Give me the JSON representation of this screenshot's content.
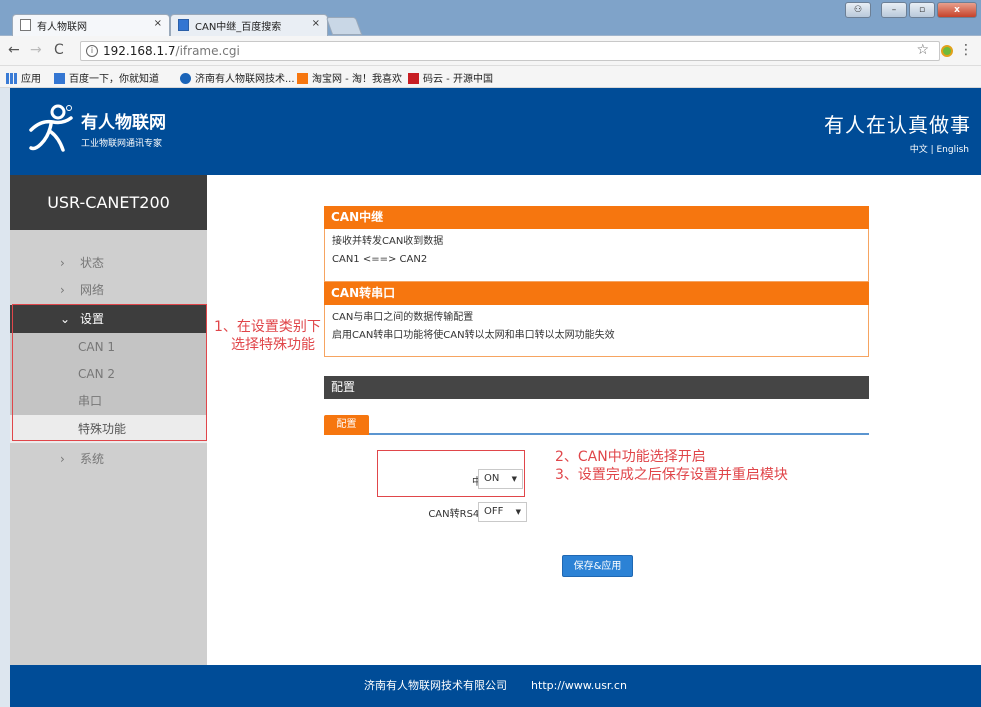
{
  "browser": {
    "tabs": [
      {
        "title": "有人物联网",
        "close": "×"
      },
      {
        "title": "CAN中继_百度搜索",
        "close": "×"
      }
    ],
    "url_host": "192.168.1.7",
    "url_path": "/iframe.cgi",
    "bookmarks": [
      "应用",
      "百度一下，你就知道",
      "济南有人物联网技术...",
      "淘宝网 - 淘！我喜欢",
      "码云 - 开源中国"
    ]
  },
  "header": {
    "brand_name": "有人物联网",
    "brand_sub": "工业物联网通讯专家",
    "slogan": "有人在认真做事",
    "lang_zh": "中文",
    "lang_sep": " | ",
    "lang_en": "English"
  },
  "sidebar": {
    "model": "USR-CANET200",
    "items": [
      {
        "chev": "›",
        "label": "状态"
      },
      {
        "chev": "›",
        "label": "网络"
      },
      {
        "chev": "⌄",
        "label": "设置"
      },
      {
        "label": "CAN 1"
      },
      {
        "label": "CAN 2"
      },
      {
        "label": "串口"
      },
      {
        "label": "特殊功能"
      },
      {
        "chev": "›",
        "label": "系统"
      }
    ]
  },
  "main": {
    "relay_title": "CAN中继",
    "relay_lines": [
      "接收并转发CAN收到数据",
      "CAN1 <==> CAN2"
    ],
    "serial_title": "CAN转串口",
    "serial_lines": [
      "CAN与串口之间的数据传输配置",
      "启用CAN转串口功能将使CAN转以太网和串口转以太网功能失效"
    ],
    "config_title": "配置",
    "config_tab": "配置",
    "fields": [
      {
        "label": "中继",
        "value": "ON"
      },
      {
        "label": "CAN转RS485",
        "value": "OFF"
      }
    ],
    "save_label": "保存&应用"
  },
  "annotations": {
    "note1_line1": "1、在设置类别下",
    "note1_line2": "选择特殊功能",
    "note2": "2、CAN中功能选择开启",
    "note3": "3、设置完成之后保存设置并重启模块"
  },
  "footer": {
    "company": "济南有人物联网技术有限公司",
    "url": "http://www.usr.cn"
  },
  "colors": {
    "brand_blue": "#004c97",
    "accent_orange": "#f6760f",
    "annotation_red": "#e0464a",
    "button_blue": "#2c82d5"
  },
  "icons": {
    "tab1": "page-icon",
    "tab2": "baidu-icon",
    "back": "back-arrow-icon",
    "forward": "forward-arrow-icon",
    "reload": "reload-icon",
    "info": "info-icon",
    "bookmark": "star-icon",
    "menu": "more-vertical-icon",
    "logo": "usr-logo-icon"
  }
}
